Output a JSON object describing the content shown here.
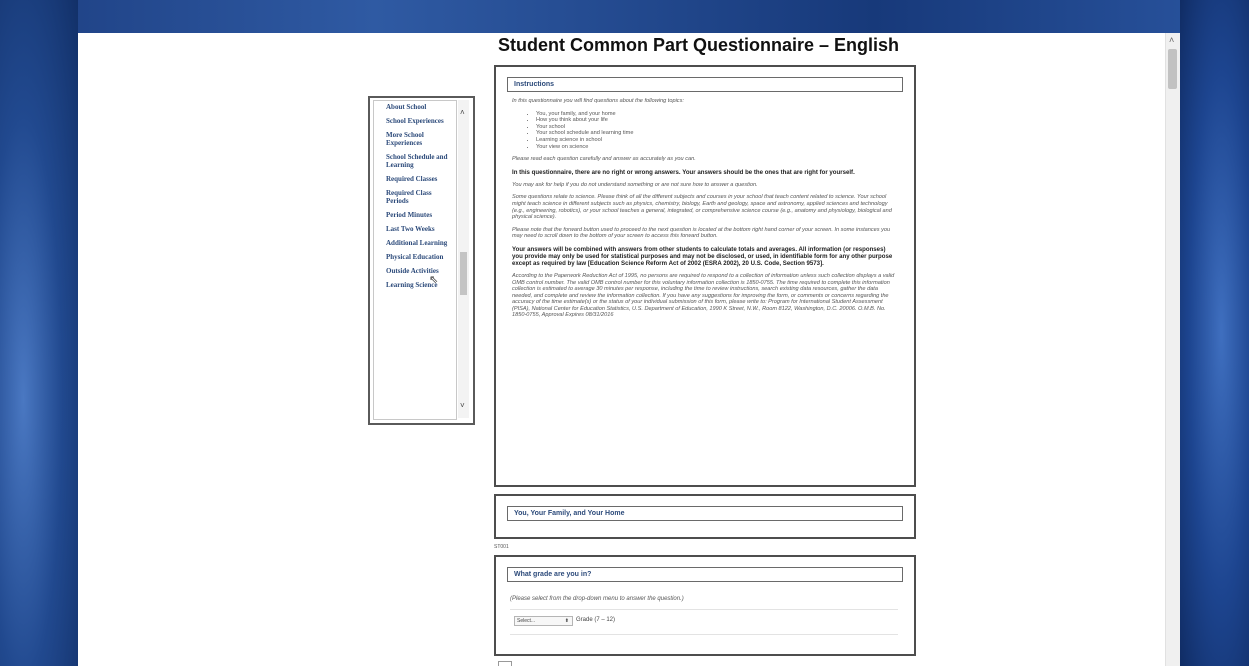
{
  "title": "Student Common Part Questionnaire – English",
  "nav": {
    "items": [
      "About School",
      "School Experiences",
      "More School Experiences",
      "School Schedule and Learning",
      "Required Classes",
      "Required Class Periods",
      "Period Minutes",
      "Last Two Weeks",
      "Additional Learning",
      "Physical Education",
      "Outside Activities",
      "Learning Science"
    ]
  },
  "instructions": {
    "header": "Instructions",
    "intro": "In this questionnaire you will find questions about the following topics:",
    "topics": [
      "You, your family, and your home",
      "How you think about your life",
      "Your school",
      "Your school schedule and learning time",
      "Learning science in school",
      "Your view on science"
    ],
    "p1": "Please read each question carefully and answer as accurately as you can.",
    "p2": "In this questionnaire, there are no right or wrong answers. Your answers should be the ones that are right for yourself.",
    "p3": "You may ask for help if you do not understand something or are not sure how to answer a question.",
    "p4": "Some questions relate to science. Please think of all the different subjects and courses in your school that teach content related to science. Your school might teach science in different subjects such as physics, chemistry, biology, Earth and geology, space and astronomy, applied sciences and technology (e.g., engineering, robotics), or your school teaches a general, integrated, or comprehensive science course (e.g., anatomy and physiology, biological and physical science).",
    "p5": "Please note that the forward button used to proceed to the next question is located at the bottom right hand corner of your screen. In some instances you may need to scroll down to the bottom of your screen to access this forward button.",
    "p6": "Your answers will be combined with answers from other students to calculate totals and averages. All information (or responses) you provide may only be used for statistical purposes and may not be disclosed, or used, in identifiable form for any other purpose except as required by law [Education Science Reform Act of 2002 (ESRA 2002), 20 U.S. Code, Section 9573].",
    "p7": "According to the Paperwork Reduction Act of 1995, no persons are required to respond to a collection of information unless such collection displays a valid OMB control number. The valid OMB control number for this voluntary information collection is 1850-0755. The time required to complete this information collection is estimated to average 30 minutes per response, including the time to review instructions, search existing data resources, gather the data needed, and complete and review the information collection. If you have any suggestions for improving the form, or comments or concerns regarding the accuracy of the time estimate(s) or the status of your individual submission of this form, please write to: Program for International Student Assessment (PISA), National Center for Education Statistics, U.S. Department of Education, 1990 K Street, N.W., Room 8122, Washington, D.C. 20006. O.M.B. No. 1850-0755, Approval Expires 08/31/2016"
  },
  "section": {
    "header": "You, Your Family, and Your Home"
  },
  "question": {
    "id": "ST001",
    "header": "What grade are you in?",
    "instruction": "(Please select from the drop-down menu to answer the question.)",
    "select_value": "Select...",
    "grade_label": "Grade (7 – 12)"
  }
}
